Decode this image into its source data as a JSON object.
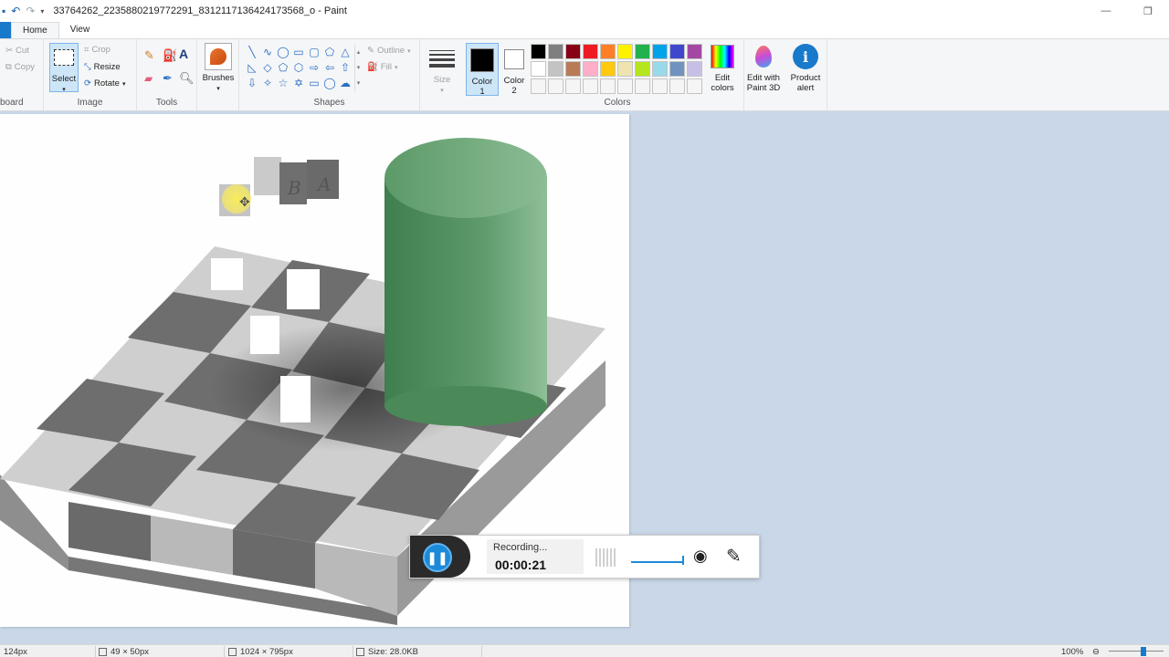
{
  "window": {
    "title": "33764262_2235880219772291_8312117136424173568_o - Paint",
    "minimize_icon": "minimize-icon",
    "maximize_icon": "maximize-icon"
  },
  "tabs": [
    {
      "label": "Home",
      "active": true
    },
    {
      "label": "View",
      "active": false
    }
  ],
  "ribbon": {
    "clipboard": {
      "label": "board",
      "cut": "Cut",
      "copy": "Copy"
    },
    "image": {
      "label": "Image",
      "select": "Select",
      "crop": "Crop",
      "resize": "Resize",
      "rotate": "Rotate"
    },
    "tools": {
      "label": "Tools"
    },
    "brushes": {
      "label": "Brushes"
    },
    "shapes": {
      "label": "Shapes",
      "outline": "Outline",
      "fill": "Fill"
    },
    "size": {
      "label": "Size"
    },
    "color1": {
      "label": "Color 1",
      "value": "#000000"
    },
    "color2": {
      "label": "Color 2",
      "value": "#ffffff"
    },
    "colors": {
      "label": "Colors",
      "edit_colors": "Edit colors",
      "swatches": [
        "#000000",
        "#7f7f7f",
        "#880015",
        "#ed1c24",
        "#ff7f27",
        "#fff200",
        "#22b14c",
        "#00a2e8",
        "#3f48cc",
        "#a349a4",
        "#ffffff",
        "#c3c3c3",
        "#b97a57",
        "#ffaec9",
        "#ffc90e",
        "#efe4b0",
        "#b5e61d",
        "#99d9ea",
        "#7092be",
        "#c8bfe7",
        "#f5f5f5",
        "#f5f5f5",
        "#f5f5f5",
        "#f5f5f5",
        "#f5f5f5",
        "#f5f5f5",
        "#f5f5f5",
        "#f5f5f5",
        "#f5f5f5",
        "#f5f5f5"
      ]
    },
    "paint3d": {
      "label": "Edit with Paint 3D"
    },
    "product_alert": {
      "label": "Product alert"
    }
  },
  "canvas": {
    "letters": [
      "B",
      "A"
    ]
  },
  "recorder": {
    "status": "Recording...",
    "time": "00:00:21"
  },
  "statusbar": {
    "position": "124px",
    "selection": "49 × 50px",
    "image_size": "1024 × 795px",
    "file_size": "Size: 28.0KB",
    "zoom": "100%"
  }
}
